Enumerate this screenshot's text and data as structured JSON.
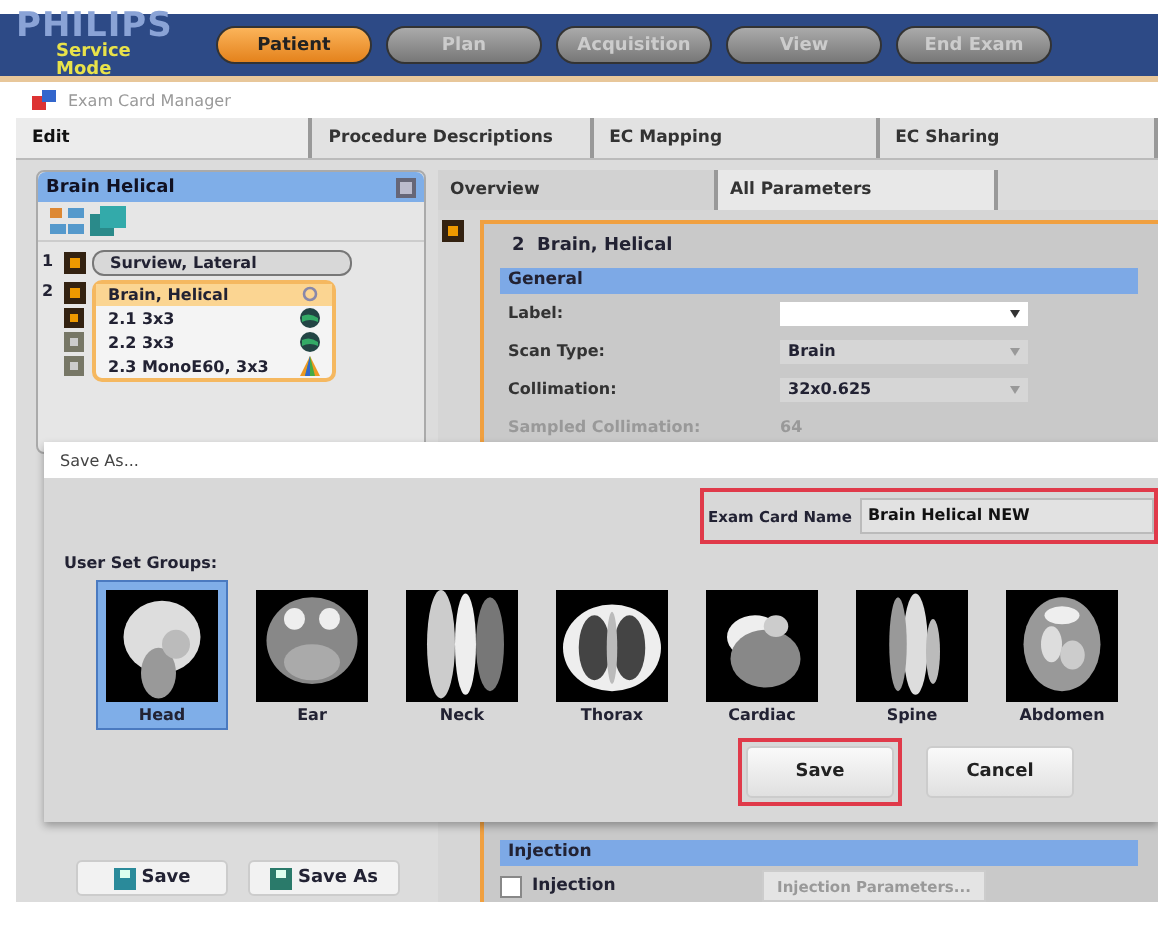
{
  "header": {
    "logo": "PHILIPS",
    "mode": "Service Mode",
    "workflow_tabs": [
      {
        "label": "Patient",
        "selected": true
      },
      {
        "label": "Plan",
        "selected": false
      },
      {
        "label": "Acquisition",
        "selected": false
      },
      {
        "label": "View",
        "selected": false
      },
      {
        "label": "End Exam",
        "selected": false
      }
    ]
  },
  "window": {
    "title": "Exam Card Manager"
  },
  "tabs": [
    {
      "label": "Edit",
      "selected": true
    },
    {
      "label": "Procedure Descriptions",
      "selected": false
    },
    {
      "label": "EC Mapping",
      "selected": false
    },
    {
      "label": "EC Sharing",
      "selected": false
    }
  ],
  "exam_card": {
    "title": "Brain Helical",
    "items": [
      {
        "number": "1",
        "label": "Surview, Lateral",
        "selected": false
      },
      {
        "number": "2",
        "label": "Brain, Helical",
        "selected": true,
        "children": [
          {
            "label": "2.1 3x3",
            "kind": "globe"
          },
          {
            "label": "2.2 3x3",
            "kind": "globe"
          },
          {
            "label": "2.3 MonoE60, 3x3",
            "kind": "triangle"
          }
        ]
      }
    ],
    "buttons": [
      "Save",
      "Save As"
    ]
  },
  "detail_tabs": [
    {
      "label": "Overview",
      "selected": false
    },
    {
      "label": "All Parameters",
      "selected": true
    }
  ],
  "detail": {
    "title": "2  Brain, Helical",
    "section": "General",
    "parameters": [
      {
        "label": "Label:",
        "kind": "editable"
      },
      {
        "label": "Scan Type:",
        "value": "Brain",
        "kind": "dropdown"
      },
      {
        "label": "Collimation:",
        "value": "32x0.625",
        "kind": "dropdown"
      },
      {
        "label": "Sampled Collimation:",
        "value": "64",
        "kind": "readonly"
      }
    ],
    "injection": {
      "section": "Injection",
      "checkbox": {
        "label": "Injection",
        "checked": false
      },
      "button": "Injection Parameters..."
    }
  },
  "dialog": {
    "title": "Save As...",
    "name_label": "Exam Card Name",
    "name_value": "Brain Helical NEW",
    "groups_label": "User Set Groups:",
    "groups": [
      {
        "label": "Head",
        "selected": true,
        "kind": "picture"
      },
      {
        "label": "Ear",
        "selected": false,
        "kind": "picture"
      },
      {
        "label": "Neck",
        "selected": false,
        "kind": "picture"
      },
      {
        "label": "Thorax",
        "selected": false,
        "kind": "picture"
      },
      {
        "label": "Cardiac",
        "selected": false,
        "kind": "picture"
      },
      {
        "label": "Spine",
        "selected": false,
        "kind": "picture"
      },
      {
        "label": "Abdomen",
        "selected": false,
        "kind": "picture"
      }
    ],
    "buttons": [
      {
        "label": "Save",
        "highlighted": true
      },
      {
        "label": "Cancel",
        "highlighted": false
      }
    ]
  }
}
